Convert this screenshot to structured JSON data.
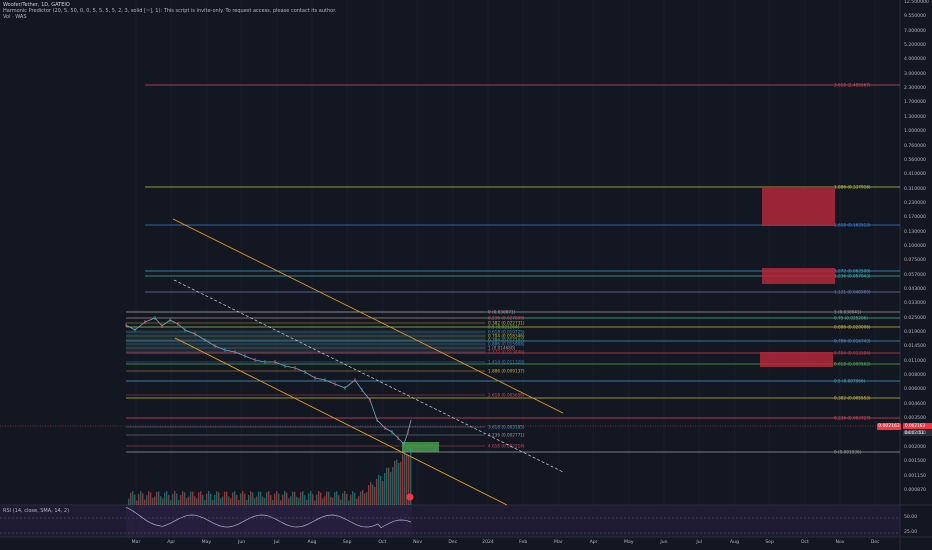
{
  "legend": {
    "title": "Woofer/Tether, 1D, GATEIO",
    "indicator": "Harmonic Predictor (20, 5, 50, 0, 0, 5, 5, 5, 5, 2, 3, solid [~], 1): This script is invite-only. To request access, please contact its author.",
    "volume": "Vol · WAS"
  },
  "rsi": {
    "label": "RSI (14, close, SMA, 14, 2)",
    "levels": [
      "50.00",
      "25.00"
    ]
  },
  "price_tag": {
    "value": "0.002163",
    "countdown": "04:02:51"
  },
  "axis_tags": [
    {
      "value": "0.002163",
      "color": "#f23645"
    },
    {
      "value": "0.002163",
      "color": "#f23645"
    }
  ],
  "price_axis": [
    "12.500000",
    "9.550000",
    "7.000000",
    "5.200000",
    "4.000000",
    "3.000000",
    "2.300000",
    "1.700000",
    "1.300000",
    "1.000000",
    "0.760000",
    "0.560000",
    "0.410000",
    "0.310000",
    "0.230000",
    "0.170000",
    "0.130000",
    "0.100000",
    "0.075000",
    "0.057000",
    "0.043000",
    "0.033000",
    "0.025000",
    "0.019000",
    "0.014500",
    "0.011000",
    "0.008000",
    "0.006000",
    "0.004600",
    "0.003500",
    "0.002600",
    "0.002000",
    "0.001500",
    "0.001150",
    "0.000870"
  ],
  "time_axis": [
    "Mar",
    "Apr",
    "May",
    "Jun",
    "Jul",
    "Aug",
    "Sep",
    "Oct",
    "Nov",
    "Dec",
    "2024",
    "Feb",
    "Mar",
    "Apr",
    "May",
    "Jun",
    "Jul",
    "Aug",
    "Sep",
    "Oct",
    "Nov",
    "Dec"
  ],
  "fib_labels": {
    "top": "3.618 (2.485567)",
    "ext_1": "1.886 (0.337916)",
    "ext_2": "1.618 (0.162513)",
    "ext_3": "1.272 (0.062508)",
    "ext_4": "1.236 (0.057043)",
    "ext_5": "1.131 (0.040969)",
    "l1": "1 (0.030041)",
    "l2": "0.75 (0.025206)",
    "l3": "0.886 (0.020006)",
    "l4": "0.786 (0.016743)",
    "l5": "0.704 (0.013384)",
    "l6": "0.618 (0.009563)",
    "l7": "0.5 (0.007066)",
    "l8": "0.382 (0.005553)",
    "l9": "0.236 (0.003727)",
    "l10": "0 (0.001936)",
    "m1": "0 (0.030071)",
    "m2": "0.236 (0.027800)",
    "m3": "0.382 (0.022731)",
    "m4": "0.5 (0.021264)",
    "m5": "0.618 (0.019725)",
    "m6": "0.704 (0.018346)",
    "m7": "0.786 (0.017102)",
    "m8": "0.886 (0.015908)",
    "m9": "1 (0.014680)",
    "m10": "1.272 (0.013846)",
    "m11": "1.414 (0.011320)",
    "m12": "1.886 (0.009137)",
    "m13": "2.618 (0.005656)",
    "m14": "3.618 (0.003185)",
    "m15": "4.236 (0.002771)",
    "m16": "4.618 (0.002214)"
  },
  "colors": {
    "background": "#131722",
    "up": "#26a69a",
    "down": "#ef5350",
    "zone_red": "#b2283a",
    "zone_green": "#4caf50",
    "channel": "#f5a623",
    "rsi": "#b2b5be"
  }
}
